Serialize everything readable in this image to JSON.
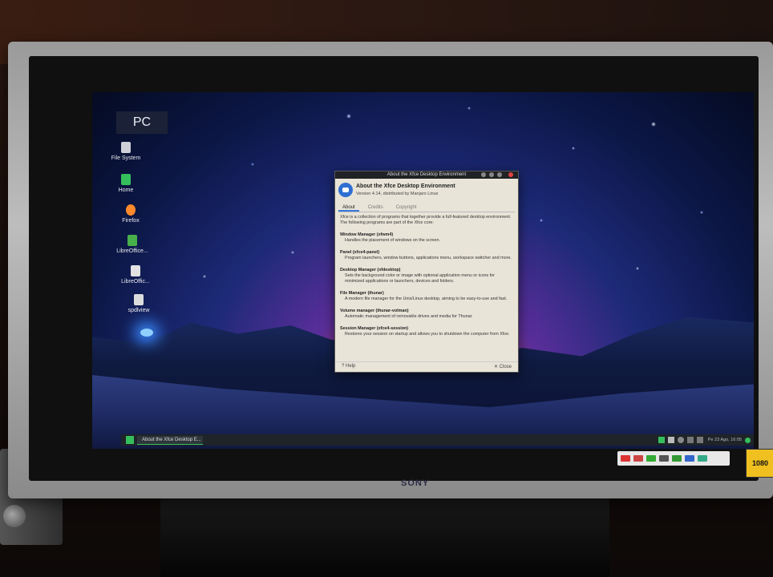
{
  "desktop": {
    "pc_label": "PC",
    "icons": [
      {
        "label": "File System",
        "icon": "drive-icon",
        "color": "#cfcfd8"
      },
      {
        "label": "Home",
        "icon": "home-folder-icon",
        "color": "#35bf5c"
      },
      {
        "label": "Firefox",
        "icon": "firefox-icon",
        "color": "#ff8a2b"
      },
      {
        "label": "LibreOffice...",
        "icon": "libreoffice-calc-icon",
        "color": "#48b04a"
      },
      {
        "label": "LibreOffic...",
        "icon": "libreoffice-doc-icon",
        "color": "#e2e2e2"
      },
      {
        "label": "spdlview",
        "icon": "document-icon",
        "color": "#dcdcdc"
      }
    ]
  },
  "dialog": {
    "window_title": "About the Xfce Desktop Environment",
    "title": "About the Xfce Desktop Environment",
    "subtitle": "Version 4.14, distributed by Manjaro Linux",
    "tabs": [
      "About",
      "Credits",
      "Copyright"
    ],
    "active_tab": "About",
    "intro": "Xfce is a collection of programs that together provide a full-featured desktop environment. The following programs are part of the Xfce core:",
    "components": [
      {
        "name": "Window Manager (xfwm4)",
        "desc": "Handles the placement of windows on the screen."
      },
      {
        "name": "Panel (xfce4-panel)",
        "desc": "Program launchers, window buttons, applications menu, workspace switcher and more."
      },
      {
        "name": "Desktop Manager (xfdesktop)",
        "desc": "Sets the background color or image with optional application menu or icons for minimized applications or launchers, devices and folders."
      },
      {
        "name": "File Manager (thunar)",
        "desc": "A modern file manager for the Unix/Linux desktop, aiming to be easy-to-use and fast."
      },
      {
        "name": "Volume manager (thunar-volman)",
        "desc": "Automatic management of removable drives and media for Thunar."
      },
      {
        "name": "Session Manager (xfce4-session)",
        "desc": "Restores your session on startup and allows you to shutdown the computer from Xfce."
      }
    ],
    "help_label": "? Help",
    "close_label": "✕ Close"
  },
  "taskbar": {
    "task_label": "About the Xfce Desktop E...",
    "clock": "Pe 23 Ago, 16:05",
    "accent": "#35bf5c"
  },
  "tv": {
    "brand": "SONY",
    "badge": "1080"
  }
}
